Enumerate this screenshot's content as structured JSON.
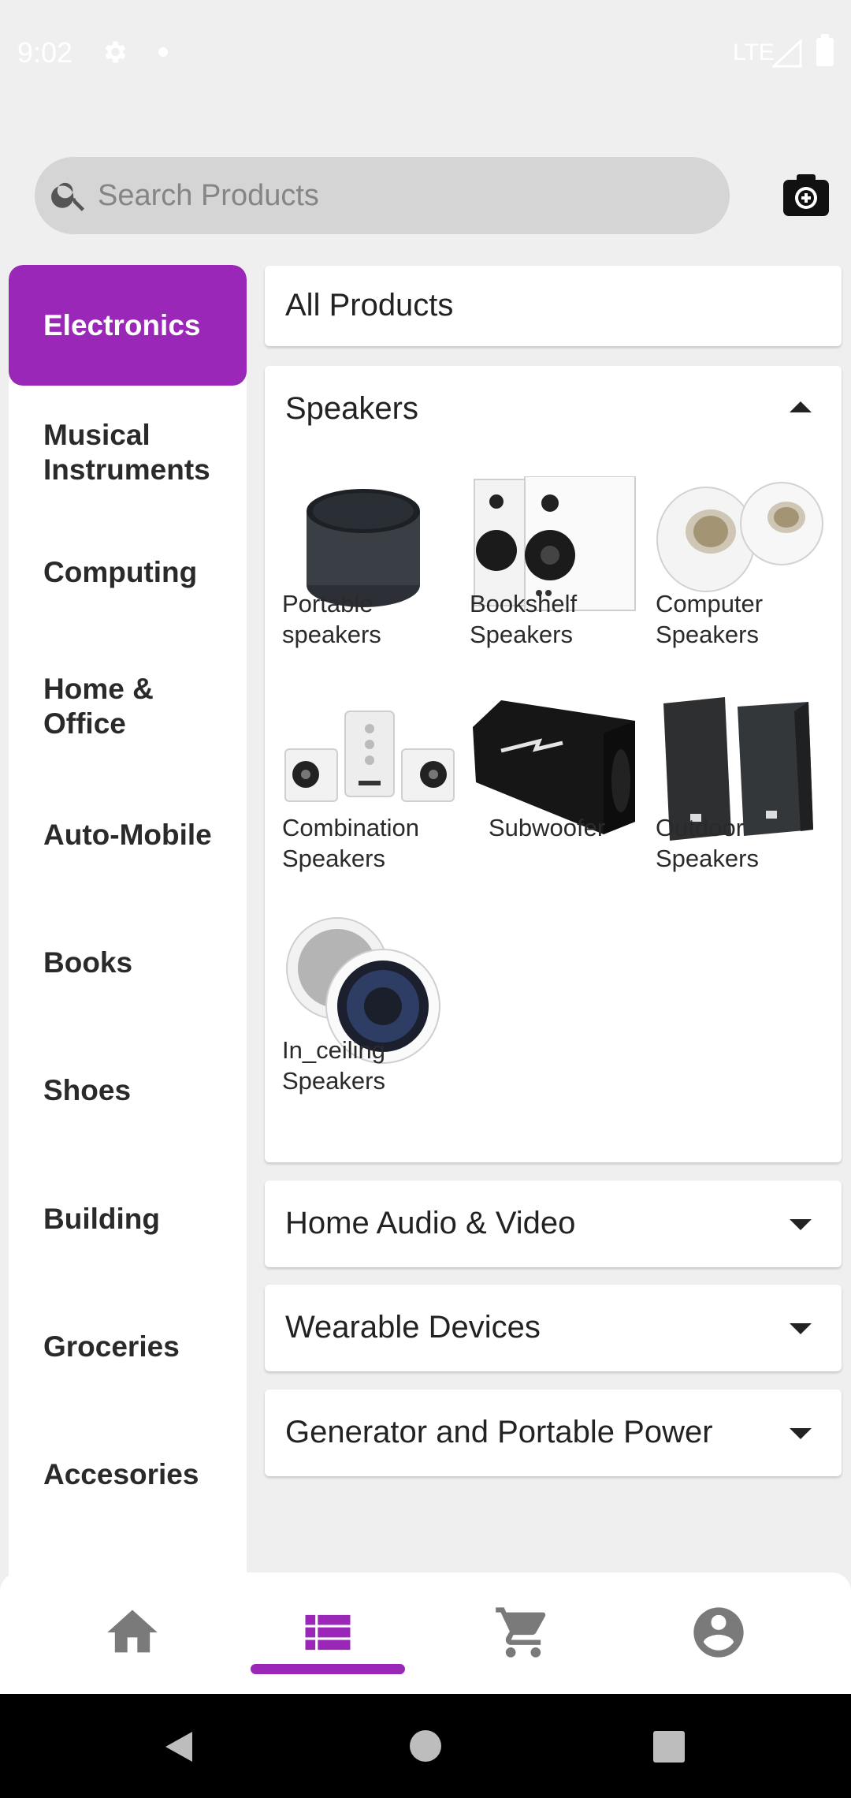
{
  "status_bar": {
    "time": "9:02",
    "network": "LTE"
  },
  "search": {
    "placeholder": "Search Products",
    "value": ""
  },
  "sidebar": {
    "items": [
      {
        "label": "Electronics",
        "active": true
      },
      {
        "label": "Musical Instruments",
        "active": false
      },
      {
        "label": "Computing",
        "active": false
      },
      {
        "label": "Home & Office",
        "active": false
      },
      {
        "label": "Auto-Mobile",
        "active": false
      },
      {
        "label": "Books",
        "active": false
      },
      {
        "label": "Shoes",
        "active": false
      },
      {
        "label": "Building",
        "active": false
      },
      {
        "label": "Groceries",
        "active": false
      },
      {
        "label": "Accesories",
        "active": false
      }
    ]
  },
  "main": {
    "all_products_label": "All Products",
    "speakers": {
      "title": "Speakers",
      "expanded": true,
      "products": [
        {
          "name": "Portable speakers",
          "icon": "portable-speaker-image"
        },
        {
          "name": "Bookshelf Speakers",
          "icon": "bookshelf-speaker-image"
        },
        {
          "name": "Computer Speakers",
          "icon": "computer-speaker-image"
        },
        {
          "name": "Combination Speakers",
          "icon": "combination-speaker-image"
        },
        {
          "name": "Subwoofer",
          "icon": "subwoofer-image"
        },
        {
          "name": "Outdoor Speakers",
          "icon": "outdoor-speaker-image"
        },
        {
          "name": "In_ceiling Speakers",
          "icon": "ceiling-speaker-image"
        }
      ]
    },
    "collapsed_sections": [
      {
        "title": "Home Audio & Video"
      },
      {
        "title": "Wearable Devices"
      },
      {
        "title": "Generator and Portable Power"
      }
    ]
  },
  "bottom_nav": {
    "items": [
      {
        "icon": "home-icon",
        "active": false
      },
      {
        "icon": "list-icon",
        "active": true
      },
      {
        "icon": "cart-icon",
        "active": false
      },
      {
        "icon": "account-icon",
        "active": false
      }
    ]
  },
  "colors": {
    "accent": "#9b27b9",
    "background": "#efefef",
    "icon_inactive": "#7a7a7a"
  }
}
